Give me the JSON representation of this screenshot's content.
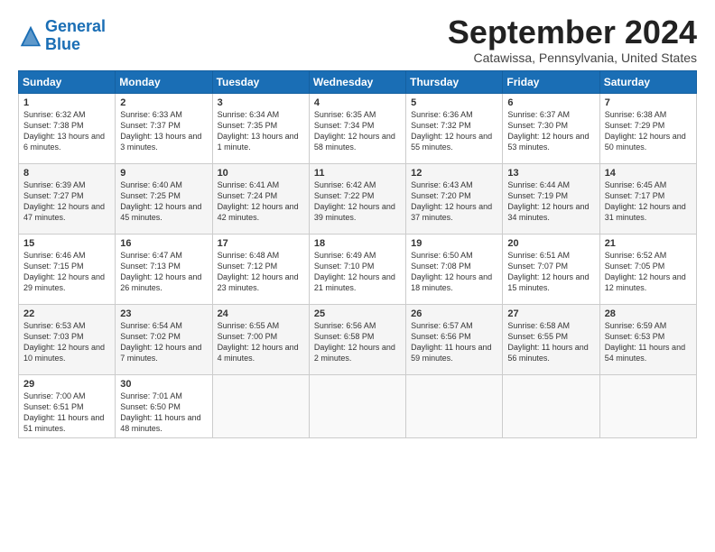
{
  "logo": {
    "line1": "General",
    "line2": "Blue"
  },
  "title": "September 2024",
  "location": "Catawissa, Pennsylvania, United States",
  "days_of_week": [
    "Sunday",
    "Monday",
    "Tuesday",
    "Wednesday",
    "Thursday",
    "Friday",
    "Saturday"
  ],
  "weeks": [
    [
      {
        "day": 1,
        "sunrise": "6:32 AM",
        "sunset": "7:38 PM",
        "daylight": "13 hours and 6 minutes."
      },
      {
        "day": 2,
        "sunrise": "6:33 AM",
        "sunset": "7:37 PM",
        "daylight": "13 hours and 3 minutes."
      },
      {
        "day": 3,
        "sunrise": "6:34 AM",
        "sunset": "7:35 PM",
        "daylight": "13 hours and 1 minute."
      },
      {
        "day": 4,
        "sunrise": "6:35 AM",
        "sunset": "7:34 PM",
        "daylight": "12 hours and 58 minutes."
      },
      {
        "day": 5,
        "sunrise": "6:36 AM",
        "sunset": "7:32 PM",
        "daylight": "12 hours and 55 minutes."
      },
      {
        "day": 6,
        "sunrise": "6:37 AM",
        "sunset": "7:30 PM",
        "daylight": "12 hours and 53 minutes."
      },
      {
        "day": 7,
        "sunrise": "6:38 AM",
        "sunset": "7:29 PM",
        "daylight": "12 hours and 50 minutes."
      }
    ],
    [
      {
        "day": 8,
        "sunrise": "6:39 AM",
        "sunset": "7:27 PM",
        "daylight": "12 hours and 47 minutes."
      },
      {
        "day": 9,
        "sunrise": "6:40 AM",
        "sunset": "7:25 PM",
        "daylight": "12 hours and 45 minutes."
      },
      {
        "day": 10,
        "sunrise": "6:41 AM",
        "sunset": "7:24 PM",
        "daylight": "12 hours and 42 minutes."
      },
      {
        "day": 11,
        "sunrise": "6:42 AM",
        "sunset": "7:22 PM",
        "daylight": "12 hours and 39 minutes."
      },
      {
        "day": 12,
        "sunrise": "6:43 AM",
        "sunset": "7:20 PM",
        "daylight": "12 hours and 37 minutes."
      },
      {
        "day": 13,
        "sunrise": "6:44 AM",
        "sunset": "7:19 PM",
        "daylight": "12 hours and 34 minutes."
      },
      {
        "day": 14,
        "sunrise": "6:45 AM",
        "sunset": "7:17 PM",
        "daylight": "12 hours and 31 minutes."
      }
    ],
    [
      {
        "day": 15,
        "sunrise": "6:46 AM",
        "sunset": "7:15 PM",
        "daylight": "12 hours and 29 minutes."
      },
      {
        "day": 16,
        "sunrise": "6:47 AM",
        "sunset": "7:13 PM",
        "daylight": "12 hours and 26 minutes."
      },
      {
        "day": 17,
        "sunrise": "6:48 AM",
        "sunset": "7:12 PM",
        "daylight": "12 hours and 23 minutes."
      },
      {
        "day": 18,
        "sunrise": "6:49 AM",
        "sunset": "7:10 PM",
        "daylight": "12 hours and 21 minutes."
      },
      {
        "day": 19,
        "sunrise": "6:50 AM",
        "sunset": "7:08 PM",
        "daylight": "12 hours and 18 minutes."
      },
      {
        "day": 20,
        "sunrise": "6:51 AM",
        "sunset": "7:07 PM",
        "daylight": "12 hours and 15 minutes."
      },
      {
        "day": 21,
        "sunrise": "6:52 AM",
        "sunset": "7:05 PM",
        "daylight": "12 hours and 12 minutes."
      }
    ],
    [
      {
        "day": 22,
        "sunrise": "6:53 AM",
        "sunset": "7:03 PM",
        "daylight": "12 hours and 10 minutes."
      },
      {
        "day": 23,
        "sunrise": "6:54 AM",
        "sunset": "7:02 PM",
        "daylight": "12 hours and 7 minutes."
      },
      {
        "day": 24,
        "sunrise": "6:55 AM",
        "sunset": "7:00 PM",
        "daylight": "12 hours and 4 minutes."
      },
      {
        "day": 25,
        "sunrise": "6:56 AM",
        "sunset": "6:58 PM",
        "daylight": "12 hours and 2 minutes."
      },
      {
        "day": 26,
        "sunrise": "6:57 AM",
        "sunset": "6:56 PM",
        "daylight": "11 hours and 59 minutes."
      },
      {
        "day": 27,
        "sunrise": "6:58 AM",
        "sunset": "6:55 PM",
        "daylight": "11 hours and 56 minutes."
      },
      {
        "day": 28,
        "sunrise": "6:59 AM",
        "sunset": "6:53 PM",
        "daylight": "11 hours and 54 minutes."
      }
    ],
    [
      {
        "day": 29,
        "sunrise": "7:00 AM",
        "sunset": "6:51 PM",
        "daylight": "11 hours and 51 minutes."
      },
      {
        "day": 30,
        "sunrise": "7:01 AM",
        "sunset": "6:50 PM",
        "daylight": "11 hours and 48 minutes."
      },
      null,
      null,
      null,
      null,
      null
    ]
  ]
}
